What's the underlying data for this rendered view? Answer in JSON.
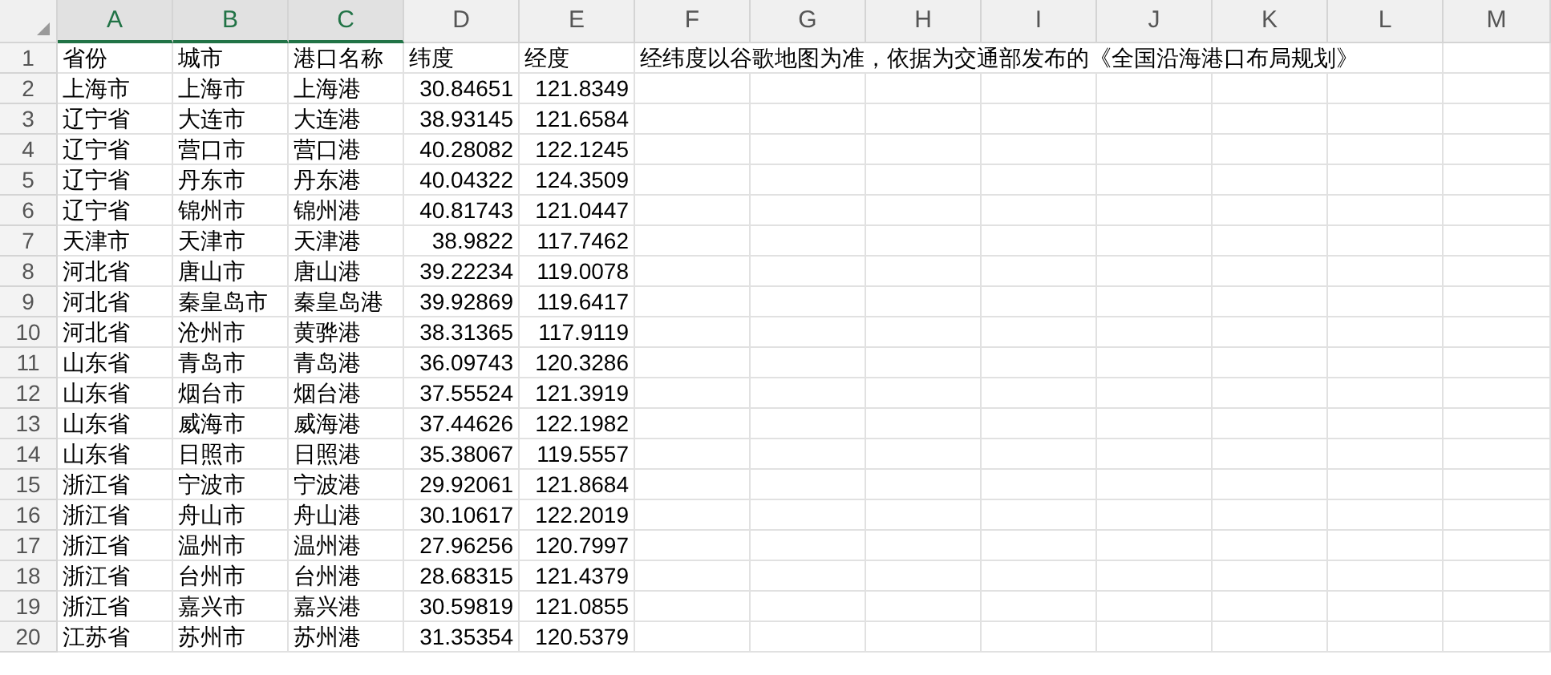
{
  "columns": [
    {
      "label": "A",
      "selected": true
    },
    {
      "label": "B",
      "selected": true
    },
    {
      "label": "C",
      "selected": true
    },
    {
      "label": "D",
      "selected": false
    },
    {
      "label": "E",
      "selected": false
    },
    {
      "label": "F",
      "selected": false
    },
    {
      "label": "G",
      "selected": false
    },
    {
      "label": "H",
      "selected": false
    },
    {
      "label": "I",
      "selected": false
    },
    {
      "label": "J",
      "selected": false
    },
    {
      "label": "K",
      "selected": false
    },
    {
      "label": "L",
      "selected": false
    },
    {
      "label": "M",
      "selected": false
    }
  ],
  "header_row": {
    "number": "1",
    "cells": [
      "省份",
      "城市",
      "港口名称",
      "纬度",
      "经度"
    ],
    "note": "经纬度以谷歌地图为准，依据为交通部发布的《全国沿海港口布局规划》"
  },
  "rows": [
    {
      "number": "2",
      "cells": [
        "上海市",
        "上海市",
        "上海港"
      ],
      "numbers": [
        "30.84651",
        "121.8349"
      ]
    },
    {
      "number": "3",
      "cells": [
        "辽宁省",
        "大连市",
        "大连港"
      ],
      "numbers": [
        "38.93145",
        "121.6584"
      ]
    },
    {
      "number": "4",
      "cells": [
        "辽宁省",
        "营口市",
        "营口港"
      ],
      "numbers": [
        "40.28082",
        "122.1245"
      ]
    },
    {
      "number": "5",
      "cells": [
        "辽宁省",
        "丹东市",
        "丹东港"
      ],
      "numbers": [
        "40.04322",
        "124.3509"
      ]
    },
    {
      "number": "6",
      "cells": [
        "辽宁省",
        "锦州市",
        "锦州港"
      ],
      "numbers": [
        "40.81743",
        "121.0447"
      ]
    },
    {
      "number": "7",
      "cells": [
        "天津市",
        "天津市",
        "天津港"
      ],
      "numbers": [
        "38.9822",
        "117.7462"
      ]
    },
    {
      "number": "8",
      "cells": [
        "河北省",
        "唐山市",
        "唐山港"
      ],
      "numbers": [
        "39.22234",
        "119.0078"
      ]
    },
    {
      "number": "9",
      "cells": [
        "河北省",
        "秦皇岛市",
        "秦皇岛港"
      ],
      "numbers": [
        "39.92869",
        "119.6417"
      ]
    },
    {
      "number": "10",
      "cells": [
        "河北省",
        "沧州市",
        "黄骅港"
      ],
      "numbers": [
        "38.31365",
        "117.9119"
      ]
    },
    {
      "number": "11",
      "cells": [
        "山东省",
        "青岛市",
        "青岛港"
      ],
      "numbers": [
        "36.09743",
        "120.3286"
      ]
    },
    {
      "number": "12",
      "cells": [
        "山东省",
        "烟台市",
        "烟台港"
      ],
      "numbers": [
        "37.55524",
        "121.3919"
      ]
    },
    {
      "number": "13",
      "cells": [
        "山东省",
        "威海市",
        "威海港"
      ],
      "numbers": [
        "37.44626",
        "122.1982"
      ]
    },
    {
      "number": "14",
      "cells": [
        "山东省",
        "日照市",
        "日照港"
      ],
      "numbers": [
        "35.38067",
        "119.5557"
      ]
    },
    {
      "number": "15",
      "cells": [
        "浙江省",
        "宁波市",
        "宁波港"
      ],
      "numbers": [
        "29.92061",
        "121.8684"
      ]
    },
    {
      "number": "16",
      "cells": [
        "浙江省",
        "舟山市",
        "舟山港"
      ],
      "numbers": [
        "30.10617",
        "122.2019"
      ]
    },
    {
      "number": "17",
      "cells": [
        "浙江省",
        "温州市",
        "温州港"
      ],
      "numbers": [
        "27.96256",
        "120.7997"
      ]
    },
    {
      "number": "18",
      "cells": [
        "浙江省",
        "台州市",
        "台州港"
      ],
      "numbers": [
        "28.68315",
        "121.4379"
      ]
    },
    {
      "number": "19",
      "cells": [
        "浙江省",
        "嘉兴市",
        "嘉兴港"
      ],
      "numbers": [
        "30.59819",
        "121.0855"
      ]
    },
    {
      "number": "20",
      "cells": [
        "江苏省",
        "苏州市",
        "苏州港"
      ],
      "numbers": [
        "31.35354",
        "120.5379"
      ]
    }
  ]
}
